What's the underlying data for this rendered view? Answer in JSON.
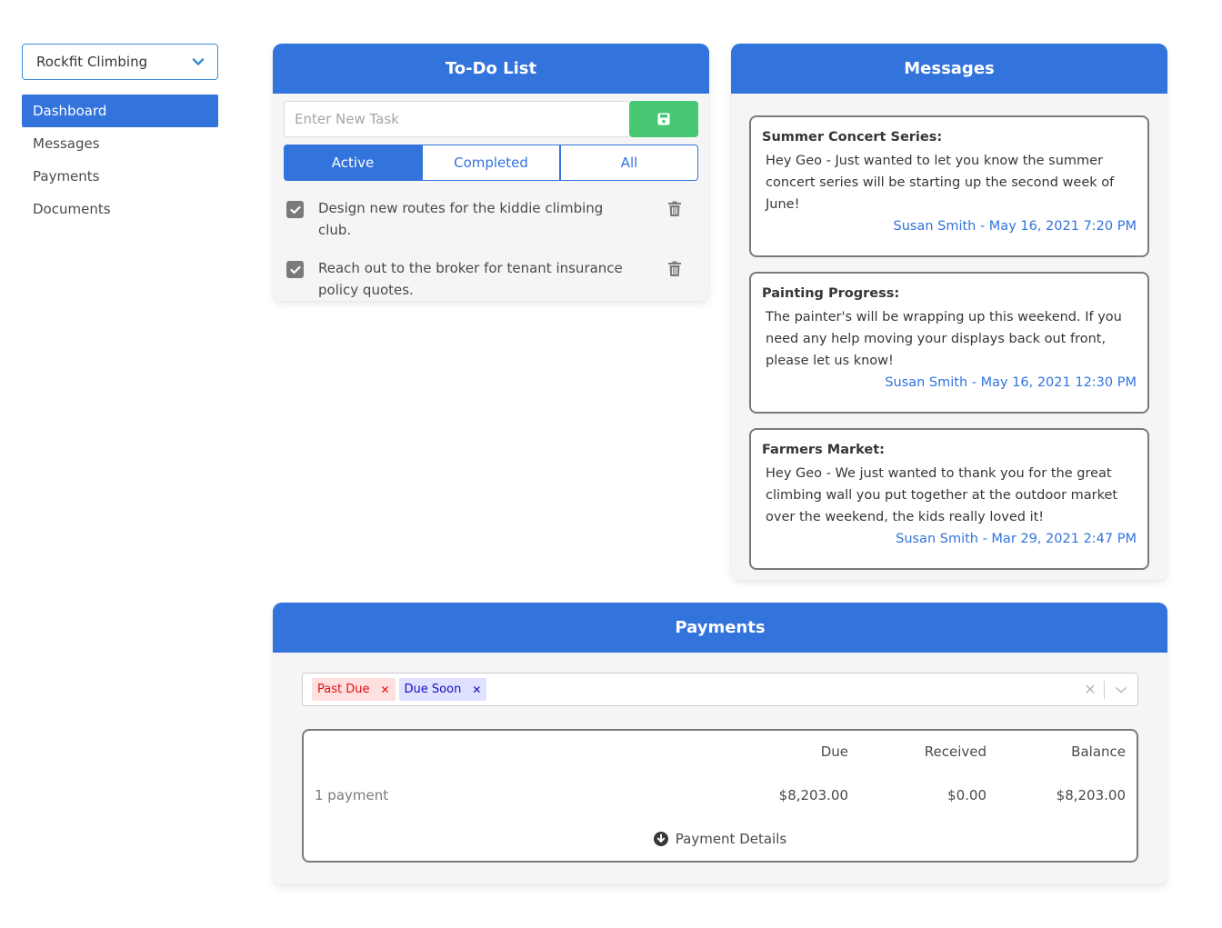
{
  "sidebar": {
    "org_select": {
      "value": "Rockfit Climbing",
      "icon": "chevron-down-icon"
    },
    "items": [
      {
        "label": "Dashboard",
        "active": true
      },
      {
        "label": "Messages",
        "active": false
      },
      {
        "label": "Payments",
        "active": false
      },
      {
        "label": "Documents",
        "active": false
      }
    ]
  },
  "todo": {
    "title": "To-Do List",
    "input": {
      "placeholder": "Enter New Task",
      "value": ""
    },
    "save_icon": "floppy-disk-icon",
    "filters": [
      {
        "label": "Active",
        "active": true
      },
      {
        "label": "Completed",
        "active": false
      },
      {
        "label": "All",
        "active": false
      }
    ],
    "tasks": [
      {
        "text": "Design new routes for the kiddie climbing club.",
        "checked": true
      },
      {
        "text": "Reach out to the broker for tenant insurance policy quotes.",
        "checked": true
      }
    ]
  },
  "messages": {
    "title": "Messages",
    "items": [
      {
        "title": "Summer Concert Series:",
        "body": "Hey Geo - Just wanted to let you know the summer concert series will be starting up the second week of June!",
        "meta": "Susan Smith - May 16, 2021 7:20 PM"
      },
      {
        "title": "Painting Progress:",
        "body": "The painter's will be wrapping up this weekend. If you need any help moving your displays back out front, please let us know!",
        "meta": "Susan Smith - May 16, 2021 12:30 PM"
      },
      {
        "title": "Farmers Market:",
        "body": "Hey Geo - We just wanted to thank you for the great climbing wall you put together at the outdoor market over the weekend, the kids really loved it!",
        "meta": "Susan Smith - Mar 29, 2021 2:47 PM"
      }
    ]
  },
  "payments": {
    "title": "Payments",
    "filters": [
      {
        "label": "Past Due",
        "color": "#e01010",
        "bg": "#ffe0e0"
      },
      {
        "label": "Due Soon",
        "color": "#1010c0",
        "bg": "#e0e0ff"
      }
    ],
    "table": {
      "headers": [
        "",
        "Due",
        "Received",
        "Balance"
      ],
      "row": [
        "1 payment",
        "$8,203.00",
        "$0.00",
        "$8,203.00"
      ],
      "details_label": "Payment Details"
    }
  },
  "colors": {
    "primary": "#3273dc",
    "success": "#48c774",
    "card_bg": "#f5f5f5"
  }
}
